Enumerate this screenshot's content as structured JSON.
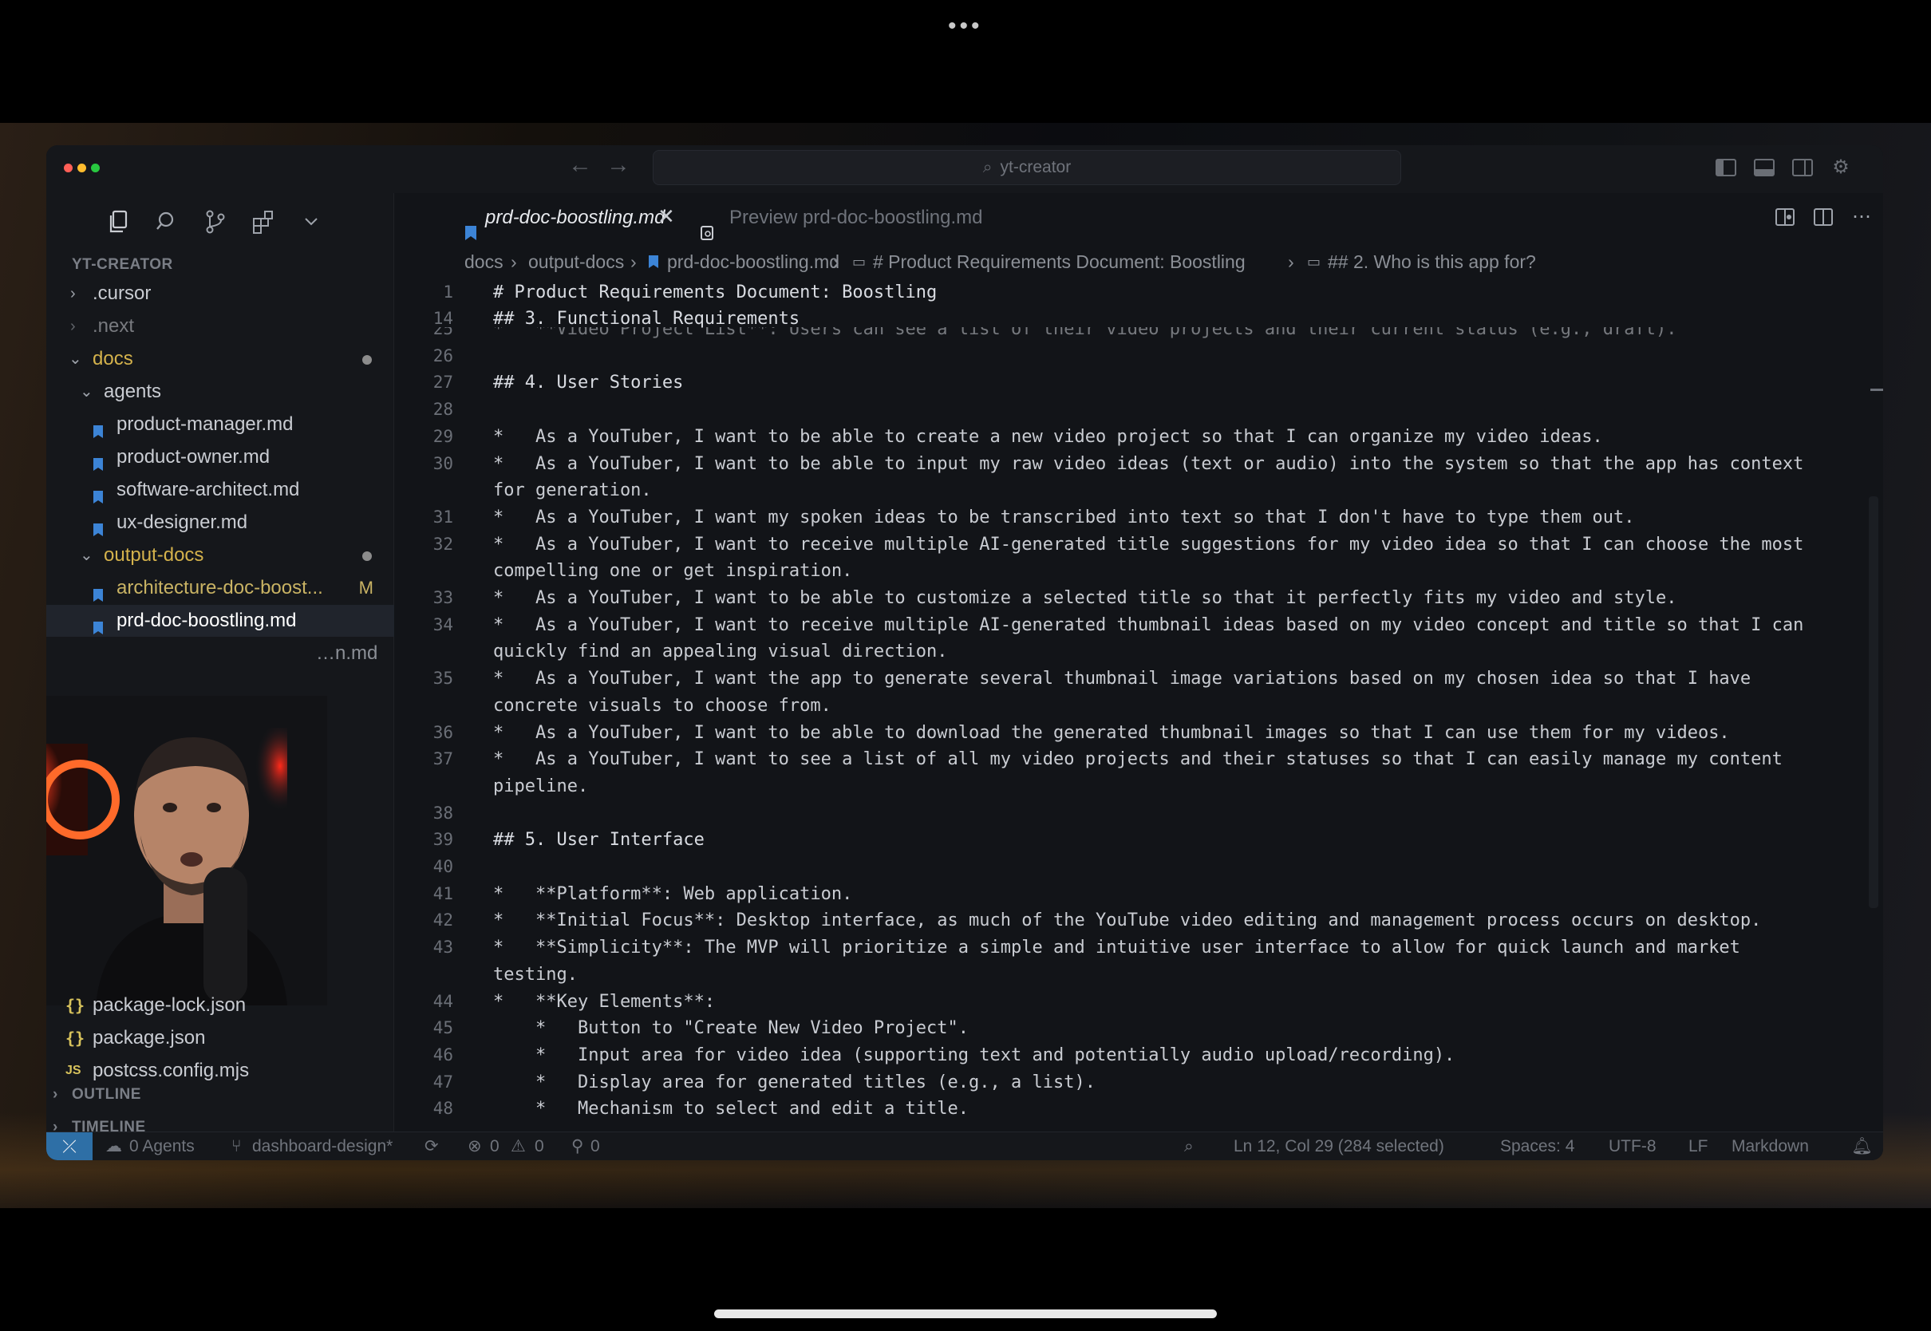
{
  "window": {
    "title": "yt-creator"
  },
  "sidebar": {
    "title": "YT-CREATOR",
    "items": [
      {
        "label": ".cursor"
      },
      {
        "label": ".next"
      },
      {
        "label": "docs"
      },
      {
        "label": "agents"
      },
      {
        "label": "product-manager.md"
      },
      {
        "label": "product-owner.md"
      },
      {
        "label": "software-architect.md"
      },
      {
        "label": "ux-designer.md"
      },
      {
        "label": "output-docs"
      },
      {
        "label": "architecture-doc-boost...",
        "badge": "M"
      },
      {
        "label": "prd-doc-boostling.md"
      },
      {
        "label": "…n.md"
      },
      {
        "label": "package-lock.json"
      },
      {
        "label": "package.json"
      },
      {
        "label": "postcss.config.mjs"
      }
    ],
    "sections": {
      "outline": "OUTLINE",
      "timeline": "TIMELINE"
    }
  },
  "tabs": [
    {
      "label": "prd-doc-boostling.md",
      "active": true
    },
    {
      "label": "Preview prd-doc-boostling.md",
      "active": false
    }
  ],
  "breadcrumb": [
    "docs",
    "output-docs",
    "prd-doc-boostling.md",
    "# Product Requirements Document: Boostling",
    "## 2. Who is this app for?"
  ],
  "editor": {
    "sticky": [
      {
        "n": "1",
        "t": "# Product Requirements Document: Boostling"
      },
      {
        "n": "14",
        "t": "## 3. Functional Requirements"
      }
    ],
    "lines": [
      {
        "n": "25",
        "t": "*   **Video Project List**: Users can see a list of their video projects and their current status (e.g., draft)."
      },
      {
        "n": "26",
        "t": ""
      },
      {
        "n": "27",
        "t": "## 4. User Stories"
      },
      {
        "n": "28",
        "t": ""
      },
      {
        "n": "29",
        "t": "*   As a YouTuber, I want to be able to create a new video project so that I can organize my video ideas."
      },
      {
        "n": "30",
        "t": "*   As a YouTuber, I want to be able to input my raw video ideas (text or audio) into the system so that the app has context"
      },
      {
        "n": "",
        "t": "for generation."
      },
      {
        "n": "31",
        "t": "*   As a YouTuber, I want my spoken ideas to be transcribed into text so that I don't have to type them out."
      },
      {
        "n": "32",
        "t": "*   As a YouTuber, I want to receive multiple AI-generated title suggestions for my video idea so that I can choose the most"
      },
      {
        "n": "",
        "t": "compelling one or get inspiration."
      },
      {
        "n": "33",
        "t": "*   As a YouTuber, I want to be able to customize a selected title so that it perfectly fits my video and style."
      },
      {
        "n": "34",
        "t": "*   As a YouTuber, I want to receive multiple AI-generated thumbnail ideas based on my video concept and title so that I can"
      },
      {
        "n": "",
        "t": "quickly find an appealing visual direction."
      },
      {
        "n": "35",
        "t": "*   As a YouTuber, I want the app to generate several thumbnail image variations based on my chosen idea so that I have"
      },
      {
        "n": "",
        "t": "concrete visuals to choose from."
      },
      {
        "n": "36",
        "t": "*   As a YouTuber, I want to be able to download the generated thumbnail images so that I can use them for my videos."
      },
      {
        "n": "37",
        "t": "*   As a YouTuber, I want to see a list of all my video projects and their statuses so that I can easily manage my content"
      },
      {
        "n": "",
        "t": "pipeline."
      },
      {
        "n": "38",
        "t": ""
      },
      {
        "n": "39",
        "t": "## 5. User Interface"
      },
      {
        "n": "40",
        "t": ""
      },
      {
        "n": "41",
        "t": "*   **Platform**: Web application."
      },
      {
        "n": "42",
        "t": "*   **Initial Focus**: Desktop interface, as much of the YouTube video editing and management process occurs on desktop."
      },
      {
        "n": "43",
        "t": "*   **Simplicity**: The MVP will prioritize a simple and intuitive user interface to allow for quick launch and market"
      },
      {
        "n": "",
        "t": "testing."
      },
      {
        "n": "44",
        "t": "*   **Key Elements**:"
      },
      {
        "n": "45",
        "t": "    *   Button to \"Create New Video Project\"."
      },
      {
        "n": "46",
        "t": "    *   Input area for video idea (supporting text and potentially audio upload/recording)."
      },
      {
        "n": "47",
        "t": "    *   Display area for generated titles (e.g., a list)."
      },
      {
        "n": "48",
        "t": "    *   Mechanism to select and edit a title."
      }
    ]
  },
  "statusbar": {
    "remote_icon": "remote-icon",
    "agents": "0 Agents",
    "branch": "dashboard-design*",
    "errors": "0",
    "warnings": "0",
    "ports": "0",
    "cursor": "Ln 12, Col 29 (284 selected)",
    "spaces": "Spaces: 4",
    "encoding": "UTF-8",
    "eol": "LF",
    "language": "Markdown"
  },
  "colors": {
    "accent": "#2e6fa6",
    "modified": "#c9b364",
    "folder_modified": "#d4b24c",
    "markdown_icon": "#3c84d6"
  }
}
